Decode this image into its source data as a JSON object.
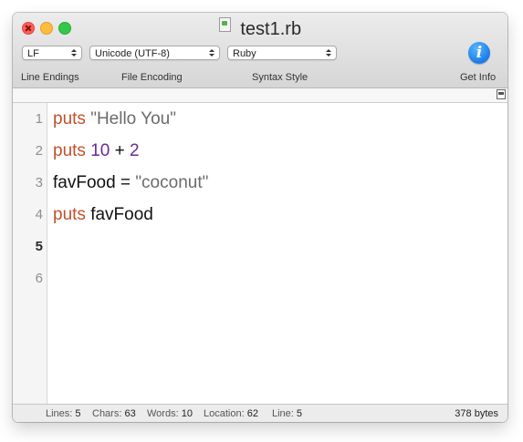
{
  "window": {
    "title": "test1.rb"
  },
  "toolbar": {
    "line_endings": {
      "value": "LF",
      "label": "Line Endings"
    },
    "file_encoding": {
      "value": "Unicode (UTF-8)",
      "label": "File Encoding"
    },
    "syntax_style": {
      "value": "Ruby",
      "label": "Syntax Style"
    },
    "get_info": {
      "label": "Get Info",
      "icon": "info-icon"
    }
  },
  "editor": {
    "current_line": 5,
    "line_numbers": [
      "1",
      "2",
      "3",
      "4",
      "5",
      "6"
    ],
    "lines": [
      {
        "tokens": [
          {
            "t": "kw",
            "v": "puts"
          },
          {
            "t": "plain",
            "v": " "
          },
          {
            "t": "str",
            "v": "\"Hello You\""
          }
        ]
      },
      {
        "tokens": [
          {
            "t": "kw",
            "v": "puts"
          },
          {
            "t": "plain",
            "v": " "
          },
          {
            "t": "num",
            "v": "10"
          },
          {
            "t": "op",
            "v": " + "
          },
          {
            "t": "num",
            "v": "2"
          }
        ]
      },
      {
        "tokens": [
          {
            "t": "plain",
            "v": "favFood"
          },
          {
            "t": "op",
            "v": " = "
          },
          {
            "t": "str",
            "v": "\"coconut\""
          }
        ]
      },
      {
        "tokens": [
          {
            "t": "kw",
            "v": "puts"
          },
          {
            "t": "plain",
            "v": " favFood"
          }
        ]
      },
      {
        "tokens": []
      },
      {
        "tokens": []
      }
    ],
    "colors": {
      "keyword": "#c0522b",
      "string": "#6b6b6b",
      "number": "#6b2a96"
    }
  },
  "status": {
    "lines_label": "Lines:",
    "lines": "5",
    "chars_label": "Chars:",
    "chars": "63",
    "words_label": "Words:",
    "words": "10",
    "location_label": "Location:",
    "location": "62",
    "line_label": "Line:",
    "line": "5",
    "size": "378 bytes"
  }
}
